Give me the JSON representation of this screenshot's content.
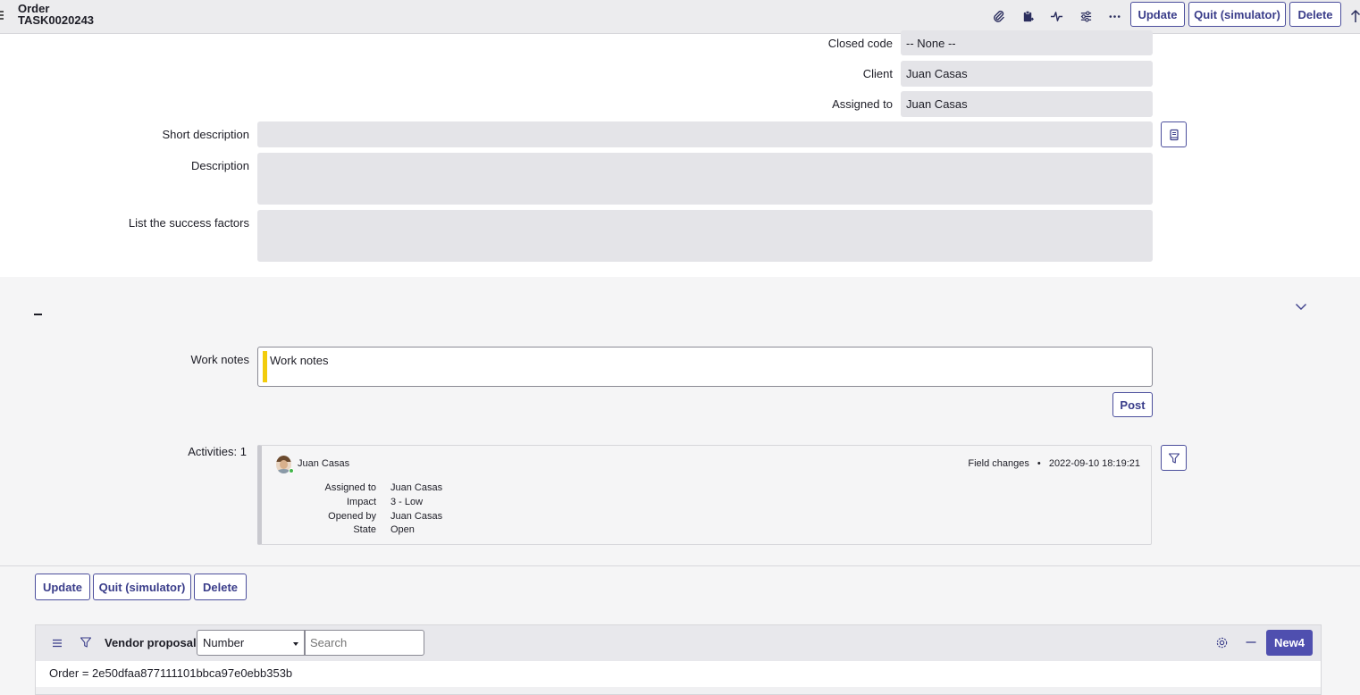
{
  "header": {
    "title": "Order",
    "subtitle": "TASK0020243",
    "icons": [
      "paperclip-icon",
      "clipboard-icon",
      "activity-icon",
      "sliders-icon",
      "more-icon"
    ],
    "buttons": {
      "update": "Update",
      "quit": "Quit (simulator)",
      "delete": "Delete"
    }
  },
  "form": {
    "closed_code": {
      "label": "Closed code",
      "value": "-- None --"
    },
    "client": {
      "label": "Client",
      "value": "Juan  Casas"
    },
    "assigned_to": {
      "label": "Assigned to",
      "value": "Juan  Casas"
    },
    "short_description": {
      "label": "Short description",
      "value": ""
    },
    "description": {
      "label": "Description",
      "value": ""
    },
    "success_factors": {
      "label": "List the success factors",
      "value": ""
    }
  },
  "work_notes": {
    "label": "Work notes",
    "placeholder": "Work notes",
    "post_label": "Post"
  },
  "activities": {
    "label": "Activities: 1",
    "entry": {
      "author": "Juan Casas",
      "type": "Field changes",
      "separator": "•",
      "timestamp": "2022-09-10 18:19:21",
      "changes": [
        {
          "field": "Assigned to",
          "value": "Juan Casas"
        },
        {
          "field": "Impact",
          "value": "3 - Low"
        },
        {
          "field": "Opened by",
          "value": "Juan Casas"
        },
        {
          "field": "State",
          "value": "Open"
        }
      ]
    }
  },
  "bottom_buttons": {
    "update": "Update",
    "quit": "Quit (simulator)",
    "delete": "Delete"
  },
  "related_list": {
    "title": "Vendor proposals",
    "select_value": "Number",
    "search_placeholder": "Search",
    "new_label": "New4",
    "filter_text": "Order = 2e50dfaa877111101bbca97e0ebb353b"
  },
  "colors": {
    "accent": "#4f4faf",
    "work_notes_bar": "#f2cc0c",
    "presence": "#42b54a"
  }
}
